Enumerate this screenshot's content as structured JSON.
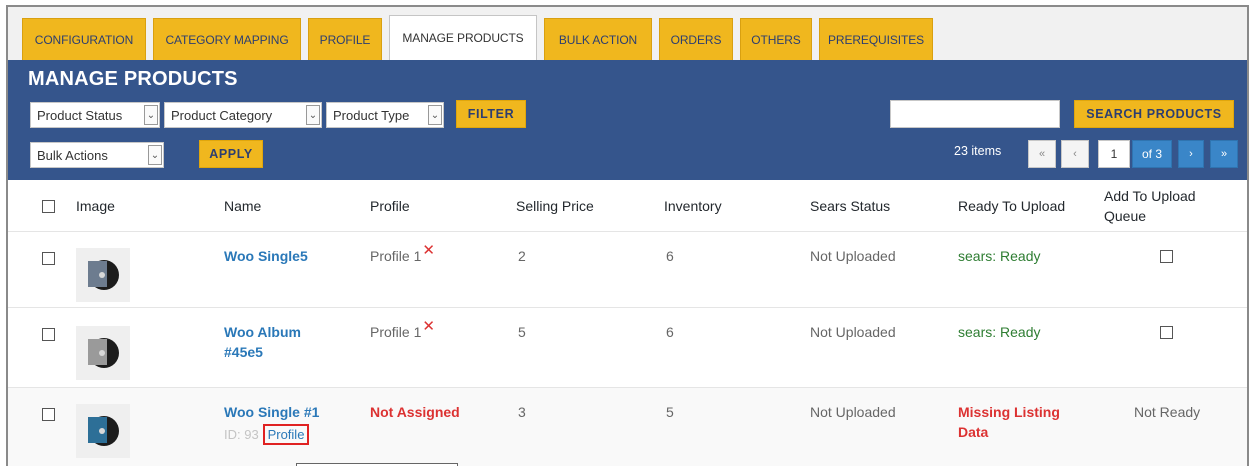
{
  "tabs": [
    {
      "label": "CONFIGURATION"
    },
    {
      "label": "CATEGORY MAPPING"
    },
    {
      "label": "PROFILE"
    },
    {
      "label": "MANAGE PRODUCTS"
    },
    {
      "label": "BULK ACTION"
    },
    {
      "label": "ORDERS"
    },
    {
      "label": "OTHERS"
    },
    {
      "label": "PREREQUISITES"
    }
  ],
  "header": {
    "title": "MANAGE PRODUCTS",
    "filters": {
      "product_status": "Product Status",
      "product_category": "Product Category",
      "product_type": "Product Type",
      "filter_label": "FILTER"
    },
    "search": {
      "value": "",
      "button_label": "SEARCH PRODUCTS"
    },
    "bulk": {
      "selected": "Bulk Actions",
      "apply_label": "APPLY"
    },
    "pagination": {
      "items_count": "23 items",
      "first": "«",
      "prev": "‹",
      "current_page": "1",
      "of_total": "of 3",
      "next": "›",
      "last": "»"
    }
  },
  "table": {
    "columns": [
      "Image",
      "Name",
      "Profile",
      "Selling Price",
      "Inventory",
      "Sears Status",
      "Ready To Upload",
      "Add To Upload Queue"
    ],
    "rows": [
      {
        "name": "Woo Single5",
        "profile": "Profile 1",
        "profile_remove": "✕",
        "price": "2",
        "inventory": "6",
        "sears_status": "Not Uploaded",
        "ready": "sears: Ready"
      },
      {
        "name": "Woo Album #45e5",
        "profile": "Profile 1",
        "profile_remove": "✕",
        "price": "5",
        "inventory": "6",
        "sears_status": "Not Uploaded",
        "ready": "sears: Ready"
      },
      {
        "name": "Woo Single #1",
        "id_text": "ID: 93",
        "profile_action": "Profile",
        "profile": "Not Assigned",
        "price": "3",
        "inventory": "5",
        "sears_status": "Not Uploaded",
        "ready": "Missing Listing Data",
        "queue": "Not Ready"
      }
    ]
  },
  "colors": {
    "tab_bg": "#f0b71e",
    "panel_bg": "#35558c",
    "link": "#2a78b8",
    "ready_green": "#2e7d32",
    "error_red": "#dc3232",
    "pager_blue": "#3a86c8"
  }
}
